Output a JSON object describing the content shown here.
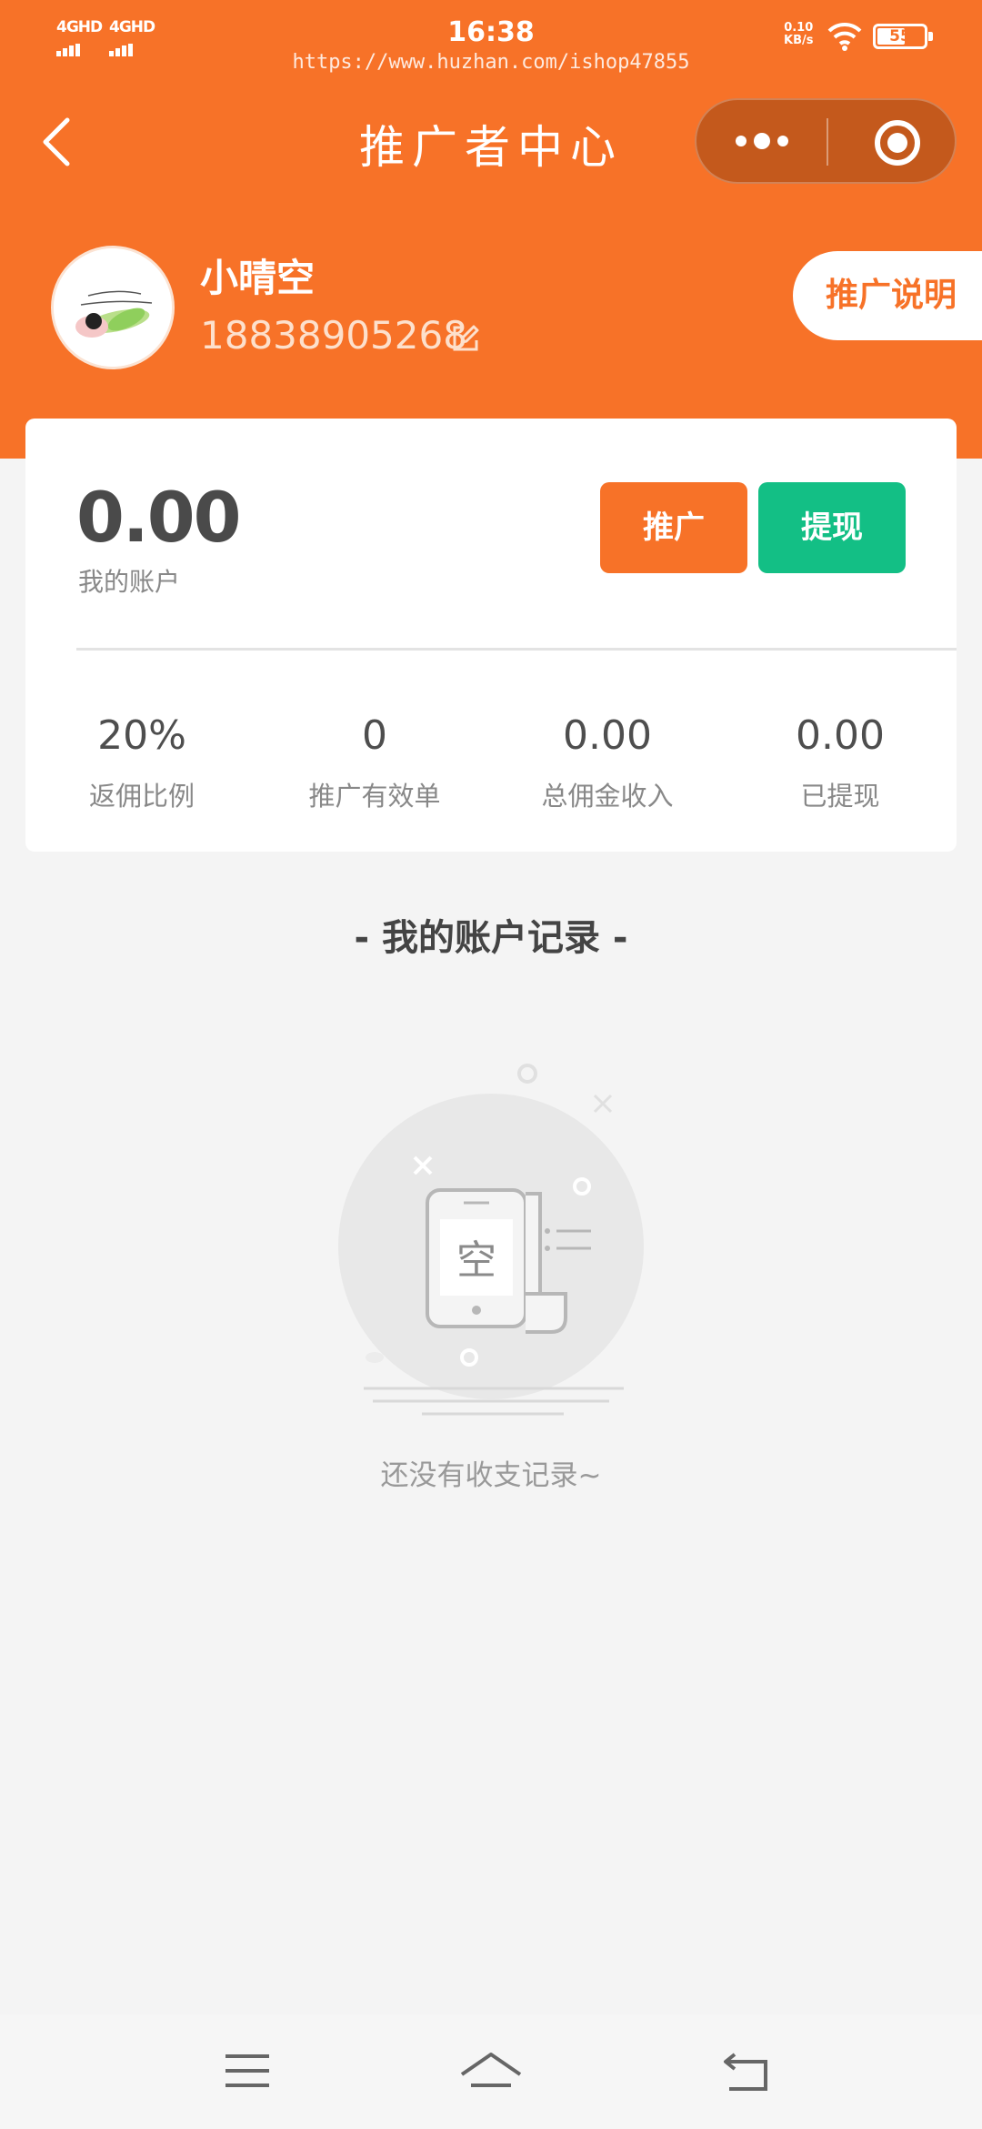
{
  "status_bar": {
    "signal_1": "4GHD",
    "signal_2": "4GHD",
    "time": "16:38",
    "watermark": "https://www.huzhan.com/ishop47855",
    "net_speed_value": "0.10",
    "net_speed_unit": "KB/s",
    "battery": "55"
  },
  "nav": {
    "title": "推广者中心"
  },
  "profile": {
    "username": "小晴空",
    "phone": "18838905268",
    "promo_desc_label": "推广说明"
  },
  "account": {
    "balance": "0.00",
    "balance_label": "我的账户",
    "promote_label": "推广",
    "withdraw_label": "提现",
    "stats": [
      {
        "value": "20%",
        "label": "返佣比例"
      },
      {
        "value": "0",
        "label": "推广有效单"
      },
      {
        "value": "0.00",
        "label": "总佣金收入"
      },
      {
        "value": "0.00",
        "label": "已提现"
      }
    ]
  },
  "records": {
    "title": "- 我的账户记录 -",
    "empty_glyph": "空",
    "empty_text": "还没有收支记录~"
  },
  "colors": {
    "brand_orange": "#f77228",
    "withdraw_green": "#13bf85"
  },
  "icons": [
    "back-icon",
    "more-icon",
    "close-target-icon",
    "edit-icon",
    "wifi-icon",
    "menu-icon",
    "home-icon",
    "return-icon"
  ]
}
